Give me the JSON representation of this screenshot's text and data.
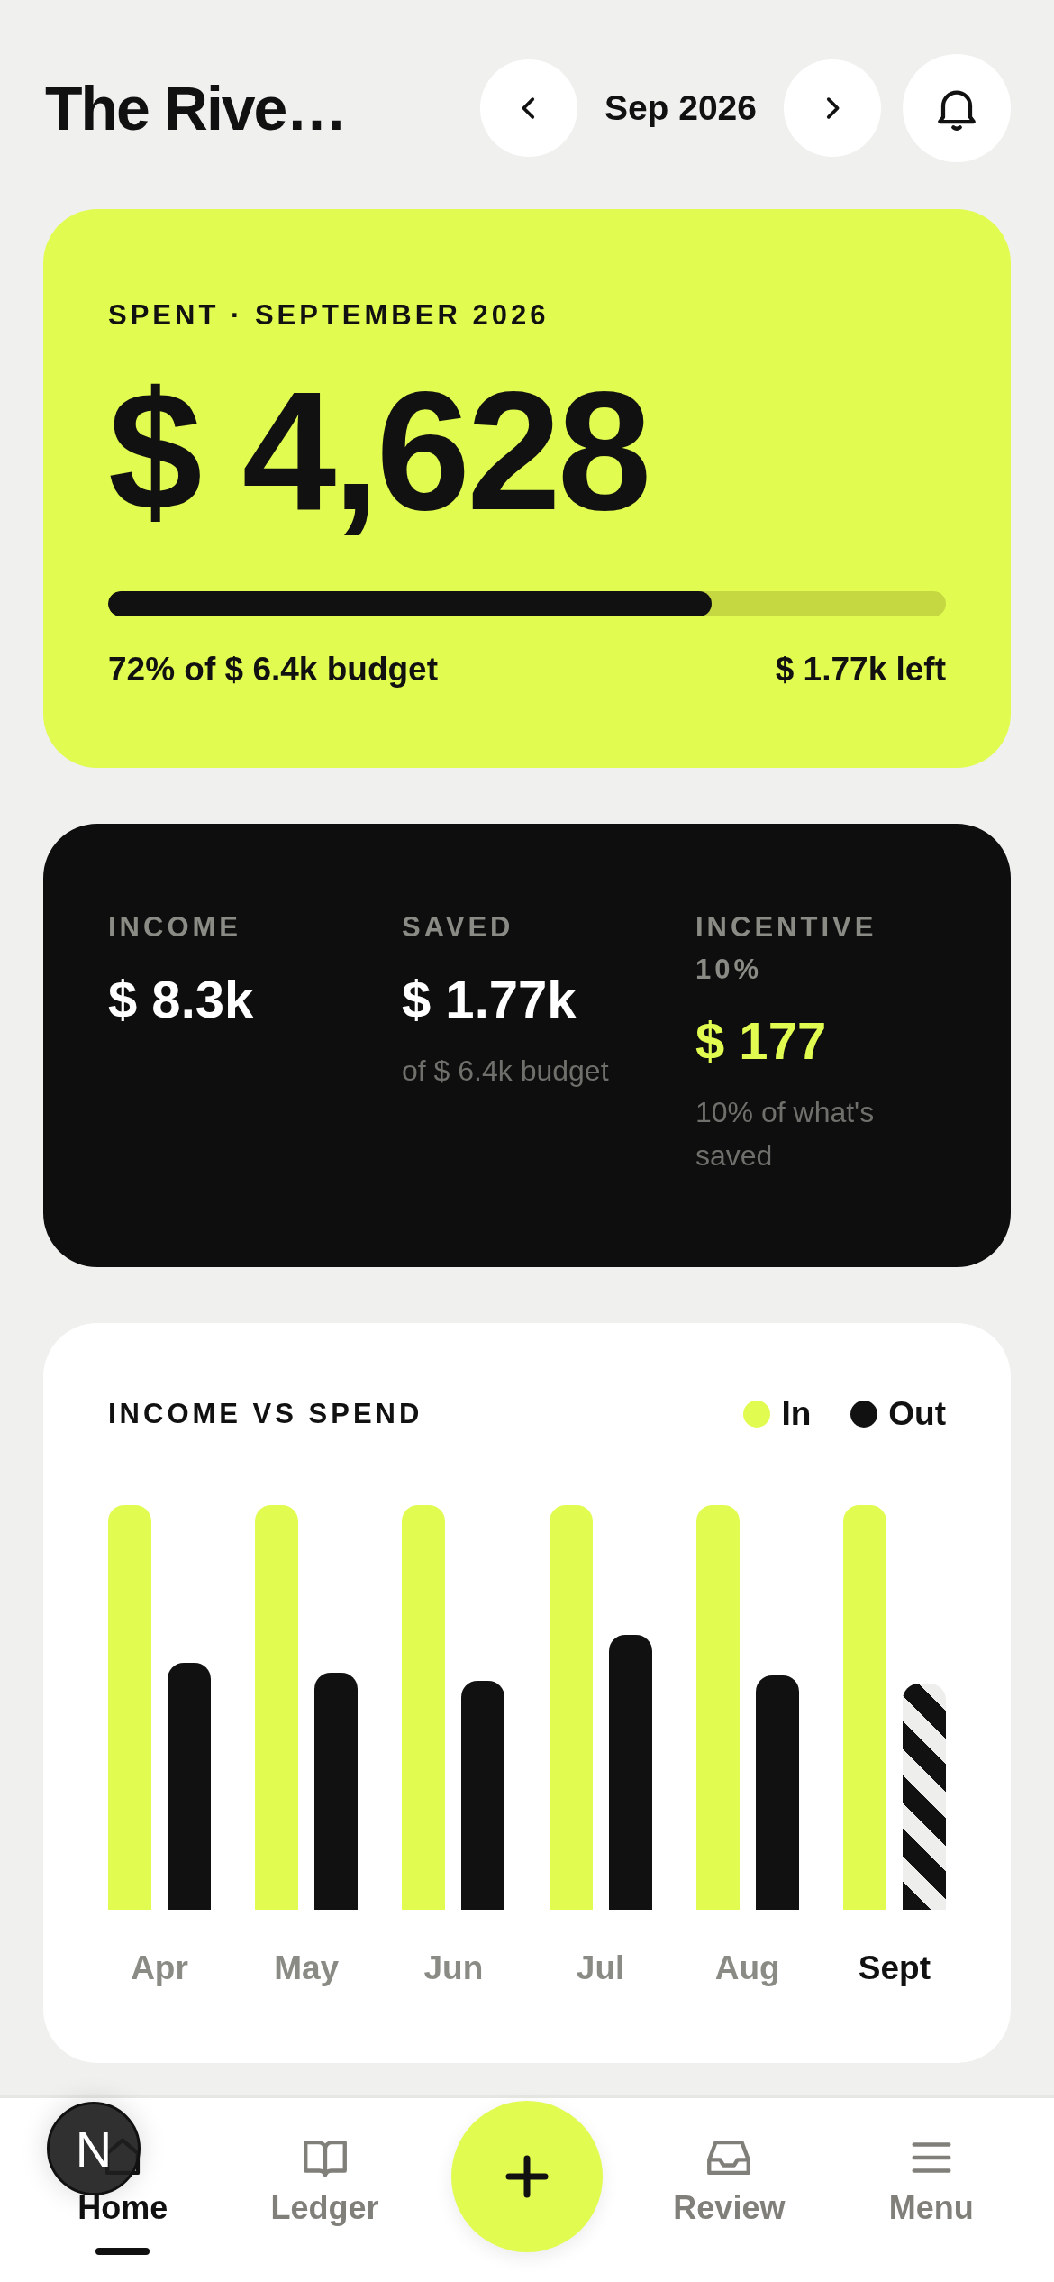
{
  "header": {
    "title": "The Rive…",
    "month": "Sep 2026"
  },
  "spent": {
    "label": "SPENT · SEPTEMBER 2026",
    "amount": "$ 4,628",
    "level": 0.72,
    "budget_text": "72% of $ 6.4k budget",
    "left_text": "$ 1.77k left"
  },
  "stats": [
    {
      "label": "INCOME",
      "value": "$ 8.3k",
      "kind": "plain"
    },
    {
      "label": "SAVED",
      "value": "$ 1.77k",
      "note": "of $ 6.4k budget",
      "kind": "plain"
    },
    {
      "label": "INCENTIVE 10%",
      "value": "$ 177",
      "note": "10% of what's saved",
      "kind": "highlight"
    }
  ],
  "chart": {
    "title": "INCOME VS SPEND",
    "legend": [
      {
        "label": "In",
        "color": "#e1fb50"
      },
      {
        "label": "Out",
        "color": "#111111"
      }
    ],
    "months": [
      {
        "label": "Apr",
        "selected": false
      },
      {
        "label": "May",
        "selected": false
      },
      {
        "label": "Jun",
        "selected": false
      },
      {
        "label": "Jul",
        "selected": false
      },
      {
        "label": "Aug",
        "selected": false
      },
      {
        "label": "Sept",
        "selected": true
      }
    ]
  },
  "nav": [
    {
      "kind": "tab",
      "label": "Home",
      "selected": true
    },
    {
      "kind": "tab",
      "label": "Ledger",
      "selected": false
    },
    {
      "kind": "add"
    },
    {
      "kind": "tab",
      "label": "Review",
      "selected": false
    },
    {
      "kind": "tab",
      "label": "Menu",
      "selected": false
    }
  ],
  "dev_badge": {
    "letter": "N"
  }
}
